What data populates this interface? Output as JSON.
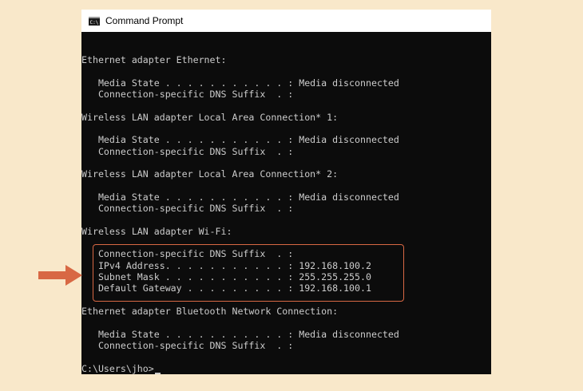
{
  "window": {
    "title": "Command Prompt",
    "icon": "console-icon"
  },
  "console": {
    "lines": [
      "Ethernet adapter Ethernet:",
      "   Media State . . . . . . . . . . . : Media disconnected",
      "   Connection-specific DNS Suffix  . :",
      "Wireless LAN adapter Local Area Connection* 1:",
      "   Media State . . . . . . . . . . . : Media disconnected",
      "   Connection-specific DNS Suffix  . :",
      "Wireless LAN adapter Local Area Connection* 2:",
      "   Media State . . . . . . . . . . . : Media disconnected",
      "   Connection-specific DNS Suffix  . :",
      "Wireless LAN adapter Wi-Fi:",
      "   Connection-specific DNS Suffix  . :",
      "   IPv4 Address. . . . . . . . . . . : 192.168.100.2",
      "   Subnet Mask . . . . . . . . . . . : 255.255.255.0",
      "   Default Gateway . . . . . . . . . : 192.168.100.1",
      "Ethernet adapter Bluetooth Network Connection:",
      "   Media State . . . . . . . . . . . : Media disconnected",
      "   Connection-specific DNS Suffix  . :"
    ],
    "prompt": "C:\\Users\\jho>"
  },
  "annotation": {
    "arrow_icon": "right-arrow-icon",
    "arrow_color": "#d86844",
    "box_color": "#d86844"
  },
  "colors": {
    "background": "#f9e8ca",
    "console_bg": "#0c0c0c",
    "console_text": "#cccccc"
  }
}
